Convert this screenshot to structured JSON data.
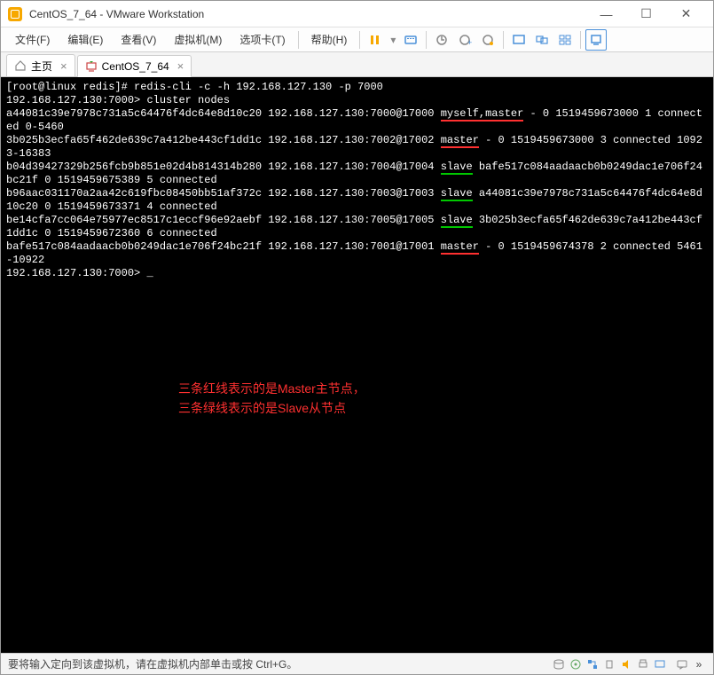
{
  "window": {
    "title": "CentOS_7_64 - VMware Workstation"
  },
  "menu": {
    "file": "文件(F)",
    "edit": "编辑(E)",
    "view": "查看(V)",
    "vm": "虚拟机(M)",
    "tabs": "选项卡(T)",
    "help": "帮助(H)"
  },
  "tabs": {
    "home": "主页",
    "vm": "CentOS_7_64"
  },
  "terminal": {
    "prompt1": "[root@linux redis]# redis-cli -c -h 192.168.127.130 -p 7000",
    "prompt2_host": "192.168.127.130:7000> ",
    "cmd2": "cluster nodes",
    "line1a": "a44081c39e7978c731a5c64476f4dc64e8d10c20 192.168.127.130:7000@17000 ",
    "line1_role": "myself,master",
    "line1b": " - 0 1519459673000 1 connected 0-5460",
    "line2a": "3b025b3ecfa65f462de639c7a412be443cf1dd1c 192.168.127.130:7002@17002 ",
    "line2_role": "master",
    "line2b": " - 0 1519459673000 3 connected 10923-16383",
    "line3a": "b04d39427329b256fcb9b851e02d4b814314b280 192.168.127.130:7004@17004 ",
    "line3_role": "slave",
    "line3b": " bafe517c084aadaacb0b0249dac1e706f24bc21f 0 1519459675389 5 connected",
    "line4a": "b96aac031170a2aa42c619fbc08450bb51af372c 192.168.127.130:7003@17003 ",
    "line4_role": "slave",
    "line4b": " a44081c39e7978c731a5c64476f4dc64e8d10c20 0 1519459673371 4 connected",
    "line5a": "be14cfa7cc064e75977ec8517c1eccf96e92aebf 192.168.127.130:7005@17005 ",
    "line5_role": "slave",
    "line5b": " 3b025b3ecfa65f462de639c7a412be443cf1dd1c 0 1519459672360 6 connected",
    "line6a": "bafe517c084aadaacb0b0249dac1e706f24bc21f 192.168.127.130:7001@17001 ",
    "line6_role": "master",
    "line6b": " - 0 1519459674378 2 connected 5461-10922",
    "prompt3": "192.168.127.130:7000> "
  },
  "annotation": {
    "line1": "三条红线表示的是Master主节点，",
    "line2": "三条绿线表示的是Slave从节点"
  },
  "statusbar": {
    "text": "要将输入定向到该虚拟机，请在虚拟机内部单击或按 Ctrl+G。"
  }
}
